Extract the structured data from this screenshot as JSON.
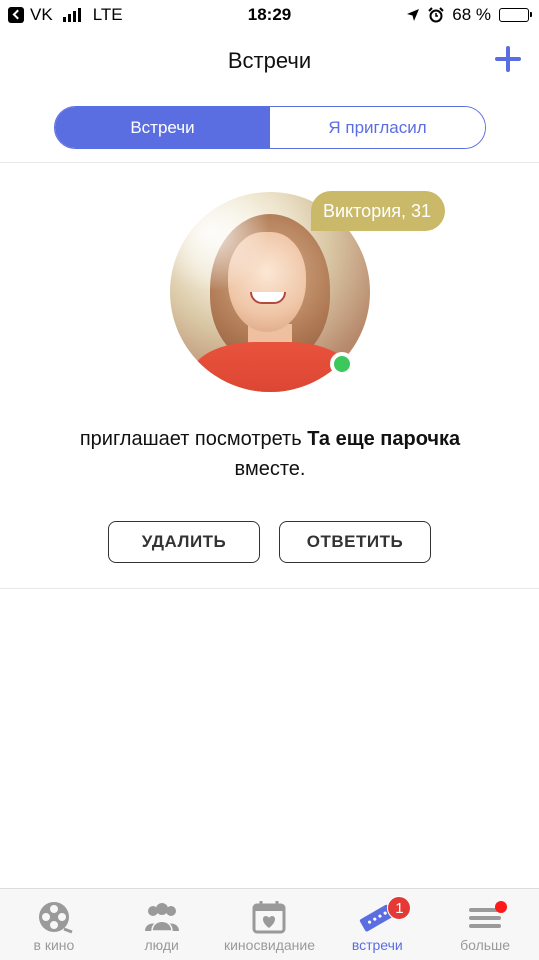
{
  "status_bar": {
    "carrier": "VK",
    "network": "LTE",
    "time": "18:29",
    "battery": "68 %",
    "battery_level": 0.68
  },
  "header": {
    "title": "Встречи",
    "add_icon": "plus-icon"
  },
  "segments": [
    {
      "label": "Встречи",
      "active": true
    },
    {
      "label": "Я пригласил",
      "active": false
    }
  ],
  "invitation": {
    "name_age": "Виктория, 31",
    "online": true,
    "text_prefix": "приглашает посмотреть ",
    "movie_title": "Та еще парочка",
    "text_suffix": " вместе.",
    "delete_label": "УДАЛИТЬ",
    "reply_label": "ОТВЕТИТЬ"
  },
  "tabs": [
    {
      "label": "в кино",
      "icon": "film-reel-icon",
      "active": false
    },
    {
      "label": "люди",
      "icon": "people-icon",
      "active": false
    },
    {
      "label": "киносвидание",
      "icon": "calendar-heart-icon",
      "active": false
    },
    {
      "label": "встречи",
      "icon": "tickets-icon",
      "active": true,
      "badge": "1"
    },
    {
      "label": "больше",
      "icon": "menu-icon",
      "active": false,
      "dot": true
    }
  ],
  "colors": {
    "accent": "#5b6ee1",
    "badge_bg": "#c9b969",
    "online": "#3cc85a",
    "notification": "#e53935"
  }
}
